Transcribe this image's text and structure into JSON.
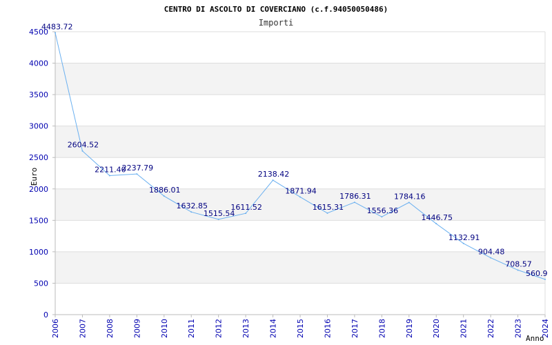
{
  "chart_data": {
    "type": "line",
    "title": "CENTRO DI ASCOLTO DI COVERCIANO (c.f.94050050486)",
    "subtitle": "Importi",
    "xlabel": "Anno",
    "ylabel": "Euro",
    "x": [
      2006,
      2007,
      2008,
      2009,
      2010,
      2011,
      2012,
      2013,
      2014,
      2015,
      2016,
      2017,
      2018,
      2019,
      2020,
      2021,
      2022,
      2023,
      2024
    ],
    "x_tick_labels": [
      "2006",
      "2007",
      "2008",
      "2009",
      "2010",
      "2011",
      "2012",
      "2013",
      "2014",
      "2015",
      "2016",
      "2017",
      "2018",
      "2019",
      "2020",
      "2021",
      "2022",
      "2023",
      "2024"
    ],
    "series": [
      {
        "values": [
          4483.72,
          2604.52,
          2211.4,
          2237.79,
          1886.01,
          1632.85,
          1515.54,
          1611.52,
          2138.42,
          1871.94,
          1615.31,
          1786.31,
          1556.36,
          1784.16,
          1446.75,
          1132.91,
          904.48,
          708.57,
          560.9
        ],
        "labels": [
          "4483.72",
          "2604.52",
          "2211.40",
          "2237.79",
          "1886.01",
          "1632.85",
          "1515.54",
          "1611.52",
          "2138.42",
          "1871.94",
          "1615.31",
          "1786.31",
          "1556.36",
          "1784.16",
          "1446.75",
          "1132.91",
          "904.48",
          "708.57",
          "560.9"
        ]
      }
    ],
    "ylim": [
      0,
      4500
    ],
    "xlim": [
      2006,
      2024
    ],
    "y_ticks": [
      0,
      500,
      1000,
      1500,
      2000,
      2500,
      3000,
      3500,
      4000,
      4500
    ],
    "y_tick_labels": [
      "0",
      "500",
      "1000",
      "1500",
      "2000",
      "2500",
      "3000",
      "3500",
      "4000",
      "4500"
    ],
    "grid": "horizontal bands",
    "legend": "none",
    "colors": {
      "line": "#6ab0f0",
      "band": "#f3f3f3",
      "grid": "#dddddd",
      "axis": "#bbbbbb",
      "tick_text": "#0000b0",
      "data_label": "#000080"
    }
  }
}
